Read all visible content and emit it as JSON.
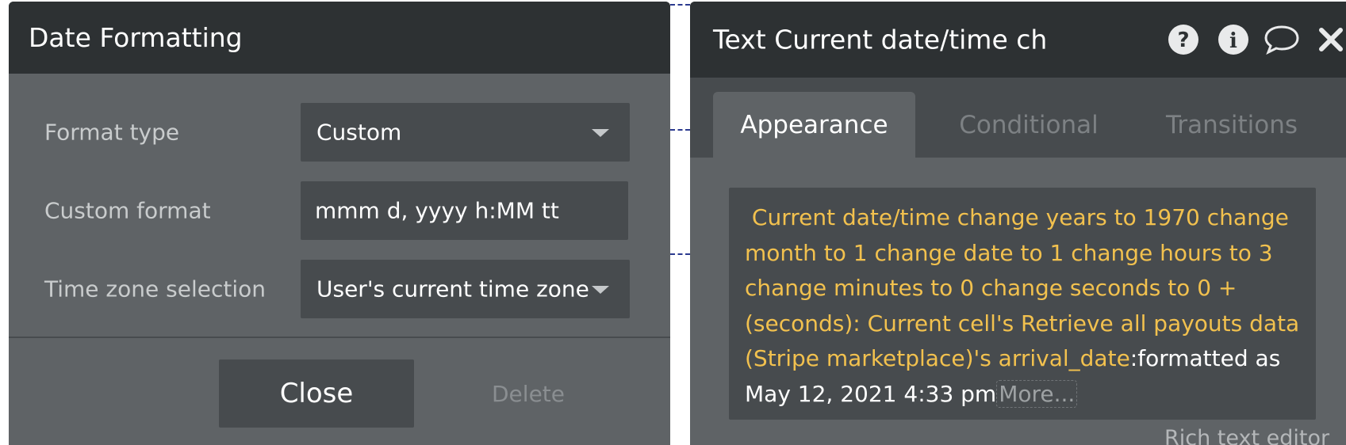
{
  "date_formatting": {
    "title": "Date Formatting",
    "fields": [
      {
        "label": "Format type",
        "value": "Custom"
      },
      {
        "label": "Custom format",
        "value": "mmm d, yyyy h:MM tt"
      },
      {
        "label": "Time zone selection",
        "value": "User's current time zone"
      }
    ],
    "close_label": "Close",
    "delete_label": "Delete"
  },
  "property_editor": {
    "title": "Text Current date/time ch",
    "icons": [
      "help-icon",
      "info-icon",
      "comment-icon",
      "close-icon"
    ],
    "tabs": [
      "Appearance",
      "Conditional",
      "Transitions"
    ],
    "content": {
      "dynamic_expression": "Current date/time change years to 1970 change month to 1 change date to 1 change hours to 3 change minutes to 0 change seconds to 0 + (seconds): Current cell's Retrieve all payouts data (Stripe marketplace)'s arrival_date",
      "static_suffix": ":formatted as May 12, 2021 4:33 pm",
      "more_label": "More..."
    },
    "rich_text_label": "Rich text editor"
  },
  "colors": {
    "header_bg": "#2d3133",
    "panel_bg": "#5f6366",
    "field_bg": "#474b4e",
    "dynamic_text": "#f2c14e",
    "connector": "#2b3a8f"
  }
}
